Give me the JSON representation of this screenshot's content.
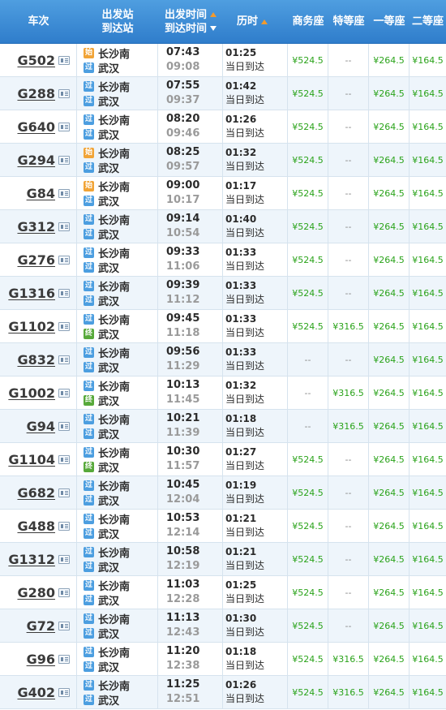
{
  "header": {
    "train": "车次",
    "station_from": "出发站",
    "station_to": "到达站",
    "time_depart": "出发时间",
    "time_arrive": "到达时间",
    "duration": "历时",
    "business": "商务座",
    "special": "特等座",
    "first": "一等座",
    "second": "二等座"
  },
  "badges": {
    "shi": "始",
    "guo": "过",
    "zhong": "终"
  },
  "rows": [
    {
      "train": "G502",
      "from": "长沙南",
      "from_badge": "始",
      "to": "武汉",
      "to_badge": "过",
      "dep": "07:43",
      "arr": "09:08",
      "dur": "01:25",
      "note": "当日到达",
      "biz": "¥524.5",
      "spc": "--",
      "first": "¥264.5",
      "second": "¥164.5"
    },
    {
      "train": "G288",
      "from": "长沙南",
      "from_badge": "过",
      "to": "武汉",
      "to_badge": "过",
      "dep": "07:55",
      "arr": "09:37",
      "dur": "01:42",
      "note": "当日到达",
      "biz": "¥524.5",
      "spc": "--",
      "first": "¥264.5",
      "second": "¥164.5"
    },
    {
      "train": "G640",
      "from": "长沙南",
      "from_badge": "过",
      "to": "武汉",
      "to_badge": "过",
      "dep": "08:20",
      "arr": "09:46",
      "dur": "01:26",
      "note": "当日到达",
      "biz": "¥524.5",
      "spc": "--",
      "first": "¥264.5",
      "second": "¥164.5"
    },
    {
      "train": "G294",
      "from": "长沙南",
      "from_badge": "始",
      "to": "武汉",
      "to_badge": "过",
      "dep": "08:25",
      "arr": "09:57",
      "dur": "01:32",
      "note": "当日到达",
      "biz": "¥524.5",
      "spc": "--",
      "first": "¥264.5",
      "second": "¥164.5"
    },
    {
      "train": "G84",
      "from": "长沙南",
      "from_badge": "始",
      "to": "武汉",
      "to_badge": "过",
      "dep": "09:00",
      "arr": "10:17",
      "dur": "01:17",
      "note": "当日到达",
      "biz": "¥524.5",
      "spc": "--",
      "first": "¥264.5",
      "second": "¥164.5"
    },
    {
      "train": "G312",
      "from": "长沙南",
      "from_badge": "过",
      "to": "武汉",
      "to_badge": "过",
      "dep": "09:14",
      "arr": "10:54",
      "dur": "01:40",
      "note": "当日到达",
      "biz": "¥524.5",
      "spc": "--",
      "first": "¥264.5",
      "second": "¥164.5"
    },
    {
      "train": "G276",
      "from": "长沙南",
      "from_badge": "过",
      "to": "武汉",
      "to_badge": "过",
      "dep": "09:33",
      "arr": "11:06",
      "dur": "01:33",
      "note": "当日到达",
      "biz": "¥524.5",
      "spc": "--",
      "first": "¥264.5",
      "second": "¥164.5"
    },
    {
      "train": "G1316",
      "from": "长沙南",
      "from_badge": "过",
      "to": "武汉",
      "to_badge": "过",
      "dep": "09:39",
      "arr": "11:12",
      "dur": "01:33",
      "note": "当日到达",
      "biz": "¥524.5",
      "spc": "--",
      "first": "¥264.5",
      "second": "¥164.5"
    },
    {
      "train": "G1102",
      "from": "长沙南",
      "from_badge": "过",
      "to": "武汉",
      "to_badge": "终",
      "dep": "09:45",
      "arr": "11:18",
      "dur": "01:33",
      "note": "当日到达",
      "biz": "¥524.5",
      "spc": "¥316.5",
      "first": "¥264.5",
      "second": "¥164.5"
    },
    {
      "train": "G832",
      "from": "长沙南",
      "from_badge": "过",
      "to": "武汉",
      "to_badge": "过",
      "dep": "09:56",
      "arr": "11:29",
      "dur": "01:33",
      "note": "当日到达",
      "biz": "--",
      "spc": "--",
      "first": "¥264.5",
      "second": "¥164.5"
    },
    {
      "train": "G1002",
      "from": "长沙南",
      "from_badge": "过",
      "to": "武汉",
      "to_badge": "终",
      "dep": "10:13",
      "arr": "11:45",
      "dur": "01:32",
      "note": "当日到达",
      "biz": "--",
      "spc": "¥316.5",
      "first": "¥264.5",
      "second": "¥164.5"
    },
    {
      "train": "G94",
      "from": "长沙南",
      "from_badge": "过",
      "to": "武汉",
      "to_badge": "过",
      "dep": "10:21",
      "arr": "11:39",
      "dur": "01:18",
      "note": "当日到达",
      "biz": "--",
      "spc": "¥316.5",
      "first": "¥264.5",
      "second": "¥164.5"
    },
    {
      "train": "G1104",
      "from": "长沙南",
      "from_badge": "过",
      "to": "武汉",
      "to_badge": "终",
      "dep": "10:30",
      "arr": "11:57",
      "dur": "01:27",
      "note": "当日到达",
      "biz": "¥524.5",
      "spc": "--",
      "first": "¥264.5",
      "second": "¥164.5"
    },
    {
      "train": "G682",
      "from": "长沙南",
      "from_badge": "过",
      "to": "武汉",
      "to_badge": "过",
      "dep": "10:45",
      "arr": "12:04",
      "dur": "01:19",
      "note": "当日到达",
      "biz": "¥524.5",
      "spc": "--",
      "first": "¥264.5",
      "second": "¥164.5"
    },
    {
      "train": "G488",
      "from": "长沙南",
      "from_badge": "过",
      "to": "武汉",
      "to_badge": "过",
      "dep": "10:53",
      "arr": "12:14",
      "dur": "01:21",
      "note": "当日到达",
      "biz": "¥524.5",
      "spc": "--",
      "first": "¥264.5",
      "second": "¥164.5"
    },
    {
      "train": "G1312",
      "from": "长沙南",
      "from_badge": "过",
      "to": "武汉",
      "to_badge": "过",
      "dep": "10:58",
      "arr": "12:19",
      "dur": "01:21",
      "note": "当日到达",
      "biz": "¥524.5",
      "spc": "--",
      "first": "¥264.5",
      "second": "¥164.5"
    },
    {
      "train": "G280",
      "from": "长沙南",
      "from_badge": "过",
      "to": "武汉",
      "to_badge": "过",
      "dep": "11:03",
      "arr": "12:28",
      "dur": "01:25",
      "note": "当日到达",
      "biz": "¥524.5",
      "spc": "--",
      "first": "¥264.5",
      "second": "¥164.5"
    },
    {
      "train": "G72",
      "from": "长沙南",
      "from_badge": "过",
      "to": "武汉",
      "to_badge": "过",
      "dep": "11:13",
      "arr": "12:43",
      "dur": "01:30",
      "note": "当日到达",
      "biz": "¥524.5",
      "spc": "--",
      "first": "¥264.5",
      "second": "¥164.5"
    },
    {
      "train": "G96",
      "from": "长沙南",
      "from_badge": "过",
      "to": "武汉",
      "to_badge": "过",
      "dep": "11:20",
      "arr": "12:38",
      "dur": "01:18",
      "note": "当日到达",
      "biz": "¥524.5",
      "spc": "¥316.5",
      "first": "¥264.5",
      "second": "¥164.5"
    },
    {
      "train": "G402",
      "from": "长沙南",
      "from_badge": "过",
      "to": "武汉",
      "to_badge": "过",
      "dep": "11:25",
      "arr": "12:51",
      "dur": "01:26",
      "note": "当日到达",
      "biz": "¥524.5",
      "spc": "¥316.5",
      "first": "¥264.5",
      "second": "¥164.5"
    }
  ]
}
